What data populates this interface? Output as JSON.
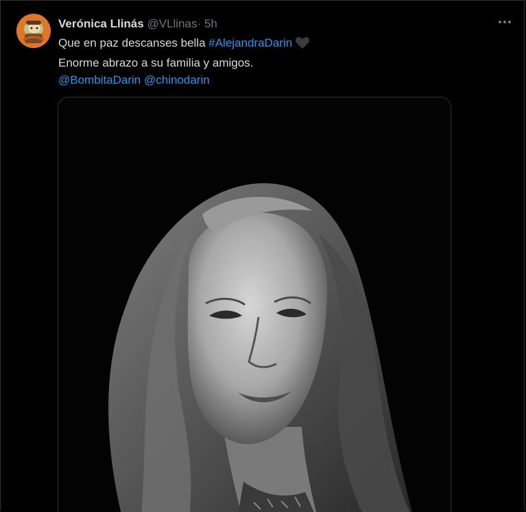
{
  "tweet": {
    "display_name": "Verónica Llinás",
    "handle": "@VLlinas",
    "separator": "·",
    "time": "5h",
    "line1_text": "Que en paz descanses bella ",
    "line1_hashtag": "#AlejandraDarin",
    "line2": "Enorme abrazo a su familia y amigos.",
    "mention1": "@BombitaDarin",
    "mention2": "@chinodarin"
  },
  "icons": {
    "avatar": "avatar-image",
    "more": "more-options-icon",
    "heart": "black-heart-emoji"
  },
  "colors": {
    "background": "#000000",
    "text": "#d9d9d9",
    "muted": "#6e767d",
    "link": "#1d9bf0",
    "border": "#2f3336"
  }
}
